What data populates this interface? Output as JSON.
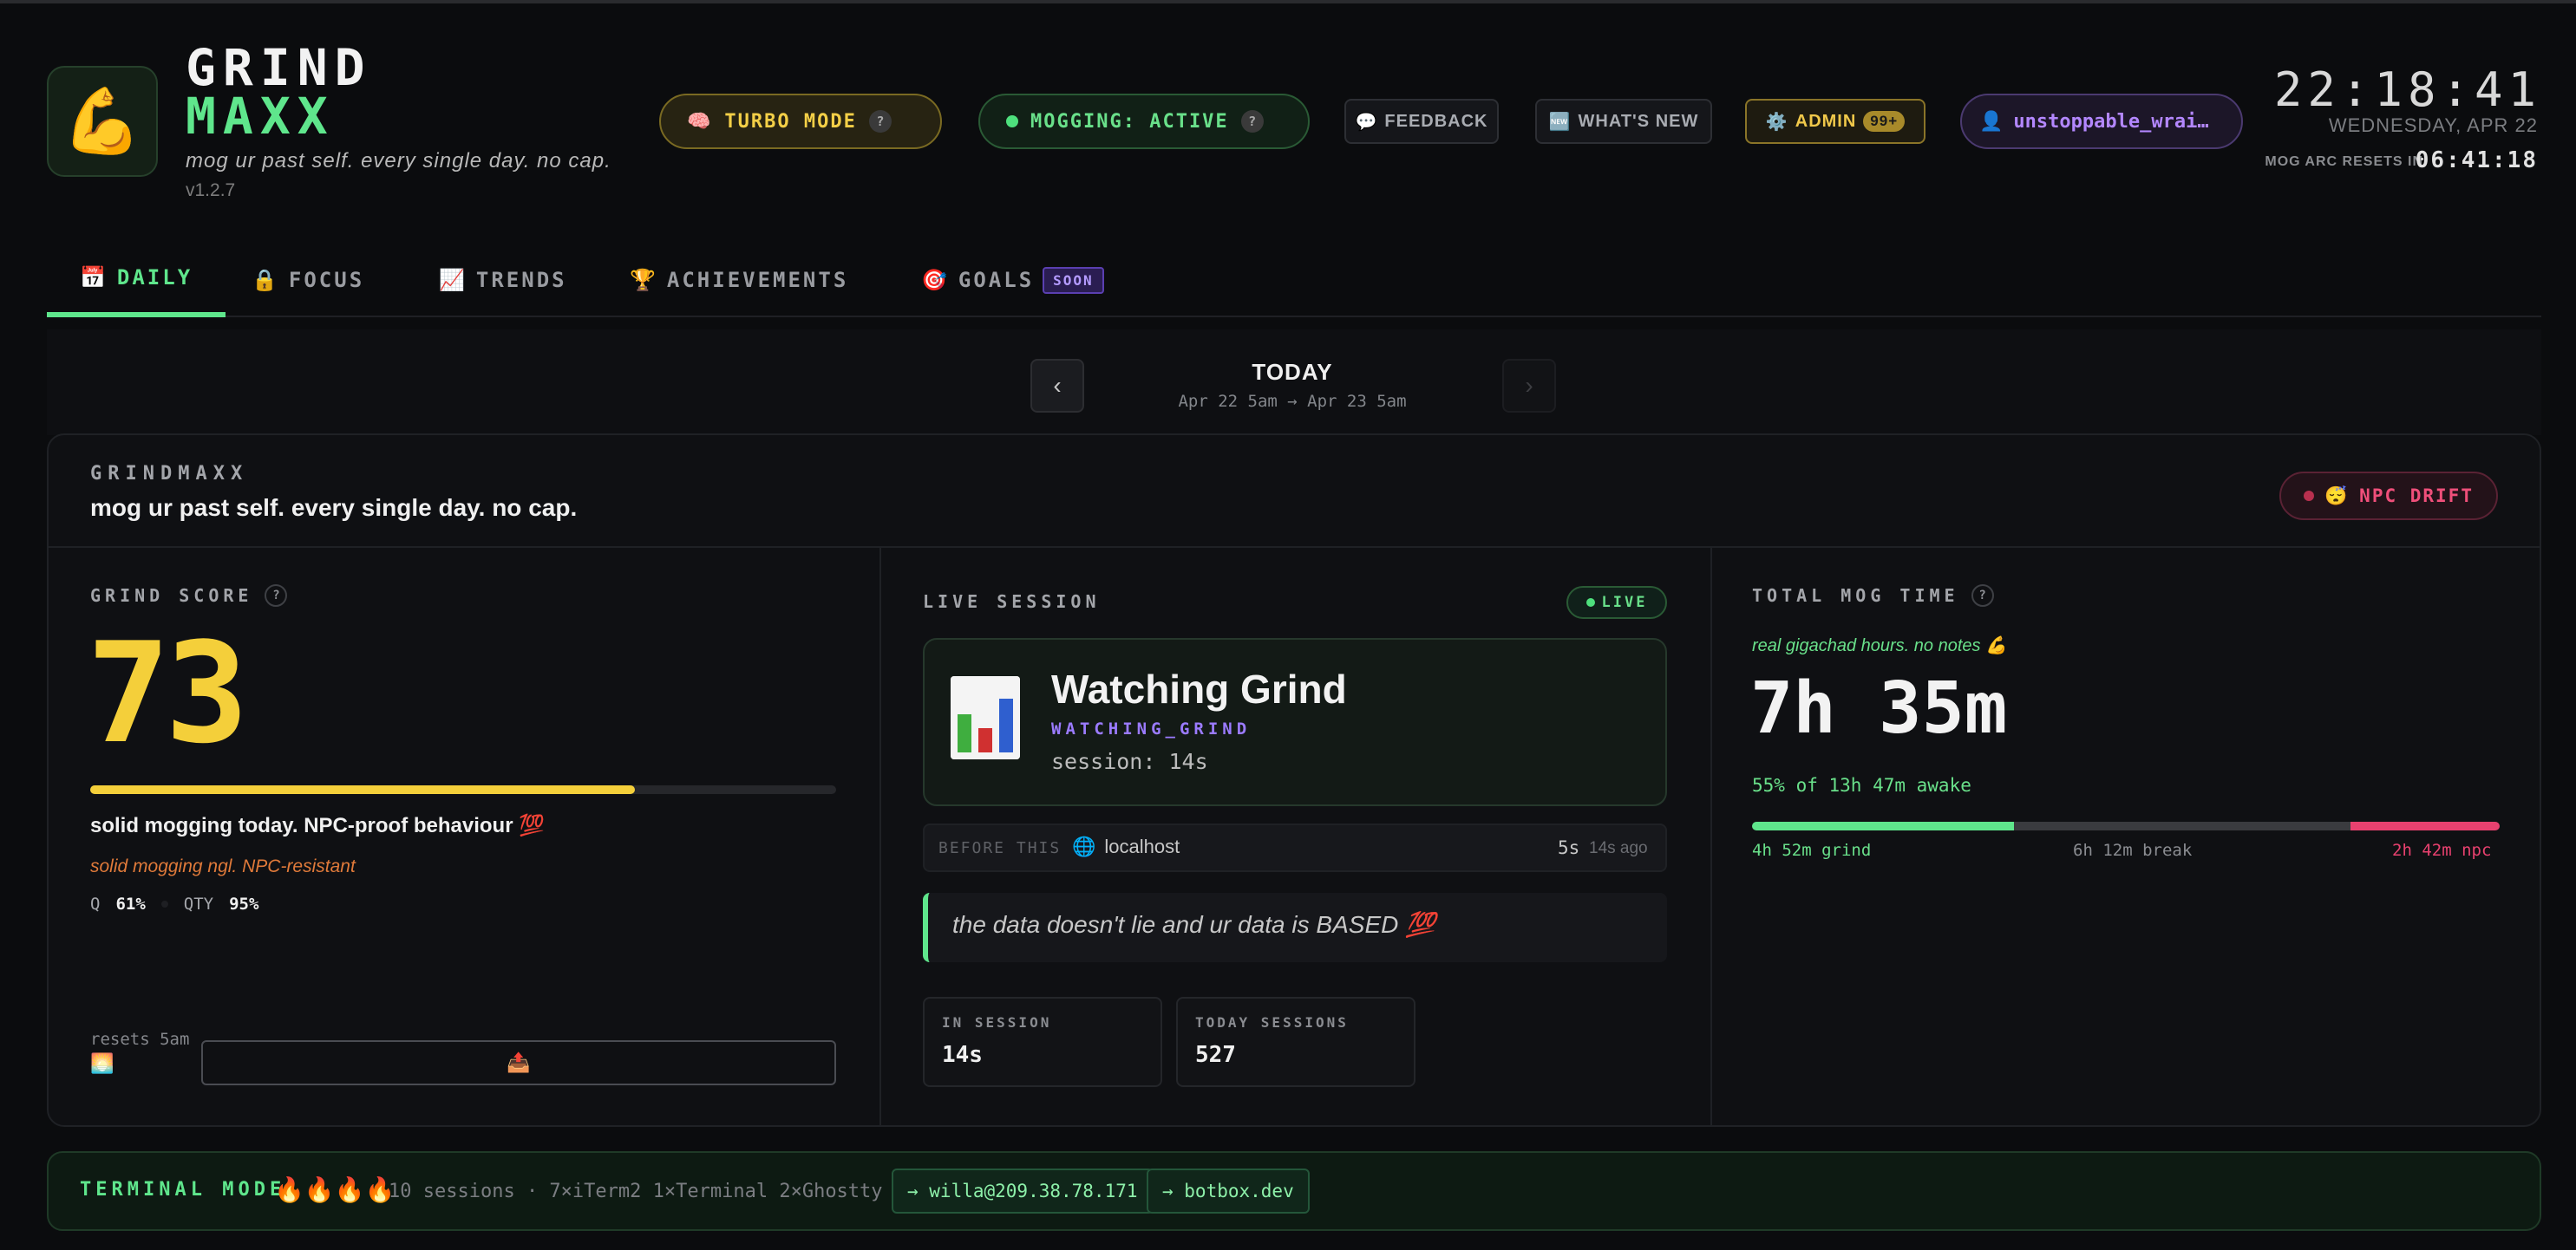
{
  "header": {
    "logo_emoji": "💪",
    "brand_line1": "GRIND",
    "brand_line2": "MAXX",
    "tagline": "mog ur past self. every single day. no cap.",
    "version": "v1.2.7",
    "turbo": {
      "icon": "🧠",
      "label": "TURBO MODE",
      "help": "?"
    },
    "mogging": {
      "label": "MOGGING: ACTIVE",
      "help": "?"
    },
    "feedback": {
      "icon": "💬",
      "label": "FEEDBACK"
    },
    "whats_new": {
      "icon": "🆕",
      "label": "WHAT'S NEW"
    },
    "admin": {
      "icon": "⚙️",
      "label": "ADMIN",
      "badge": "99+"
    },
    "user": {
      "icon": "👤",
      "name": "unstoppable_wrai…"
    },
    "clock": "22:18:41",
    "date": "WEDNESDAY, APR 22",
    "arc_label": "MOG ARC RESETS IN",
    "arc_countdown": "06:41:18"
  },
  "tabs": [
    {
      "icon": "📅",
      "label": "DAILY",
      "active": true
    },
    {
      "icon": "🔒",
      "label": "FOCUS"
    },
    {
      "icon": "📈",
      "label": "TRENDS"
    },
    {
      "icon": "🏆",
      "label": "ACHIEVEMENTS"
    },
    {
      "icon": "🎯",
      "label": "GOALS",
      "badge": "SOON"
    }
  ],
  "daynav": {
    "prev": "‹",
    "next": "›",
    "title": "TODAY",
    "range": "Apr 22 5am → Apr 23 5am"
  },
  "card": {
    "label": "GRINDMAXX",
    "subtitle": "mog ur past self. every single day. no cap.",
    "status": {
      "icon": "😴",
      "label": "NPC DRIFT"
    }
  },
  "grind": {
    "label": "GRIND SCORE",
    "help": "?",
    "score": "73",
    "score_fraction": 0.73,
    "summary": "solid mogging today. NPC-proof behaviour 💯",
    "quip": "solid mogging ngl. NPC-resistant",
    "q_label": "Q",
    "q_value": "61%",
    "qty_label": "QTY",
    "qty_value": "95%",
    "resets": "resets 5am",
    "sunrise_icon": "🌅",
    "upload_icon": "📤"
  },
  "live": {
    "label": "LIVE SESSION",
    "badge": "LIVE",
    "title": "Watching Grind",
    "key": "WATCHING_GRIND",
    "session": "session: 14s",
    "before_label": "BEFORE THIS",
    "before_icon": "🌐",
    "before_host": "localhost",
    "before_time": "5s",
    "before_ago": "14s ago",
    "quote": "the data doesn't lie and ur data is BASED 💯",
    "in_session_label": "IN SESSION",
    "in_session_value": "14s",
    "today_sessions_label": "TODAY SESSIONS",
    "today_sessions_value": "527"
  },
  "mog": {
    "label": "TOTAL MOG TIME",
    "help": "?",
    "quip": "real gigachad hours. no notes 💪",
    "time": "7h 35m",
    "awake": "55% of 13h 47m awake",
    "grind_label": "4h 52m grind",
    "break_label": "6h 12m break",
    "npc_label": "2h 42m npc",
    "grind_fraction": 0.35,
    "break_fraction": 0.45,
    "npc_fraction": 0.2,
    "colors": {
      "grind": "#5fe68c",
      "break": "#3a3b3f",
      "npc": "#e8416f"
    }
  },
  "terminal": {
    "label": "TERMINAL MODE",
    "fires": "🔥🔥🔥🔥",
    "info": "10 sessions · 7×iTerm2 1×Terminal 2×Ghostty",
    "link1": "→ willa@209.38.78.171",
    "link2": "→ botbox.dev"
  }
}
